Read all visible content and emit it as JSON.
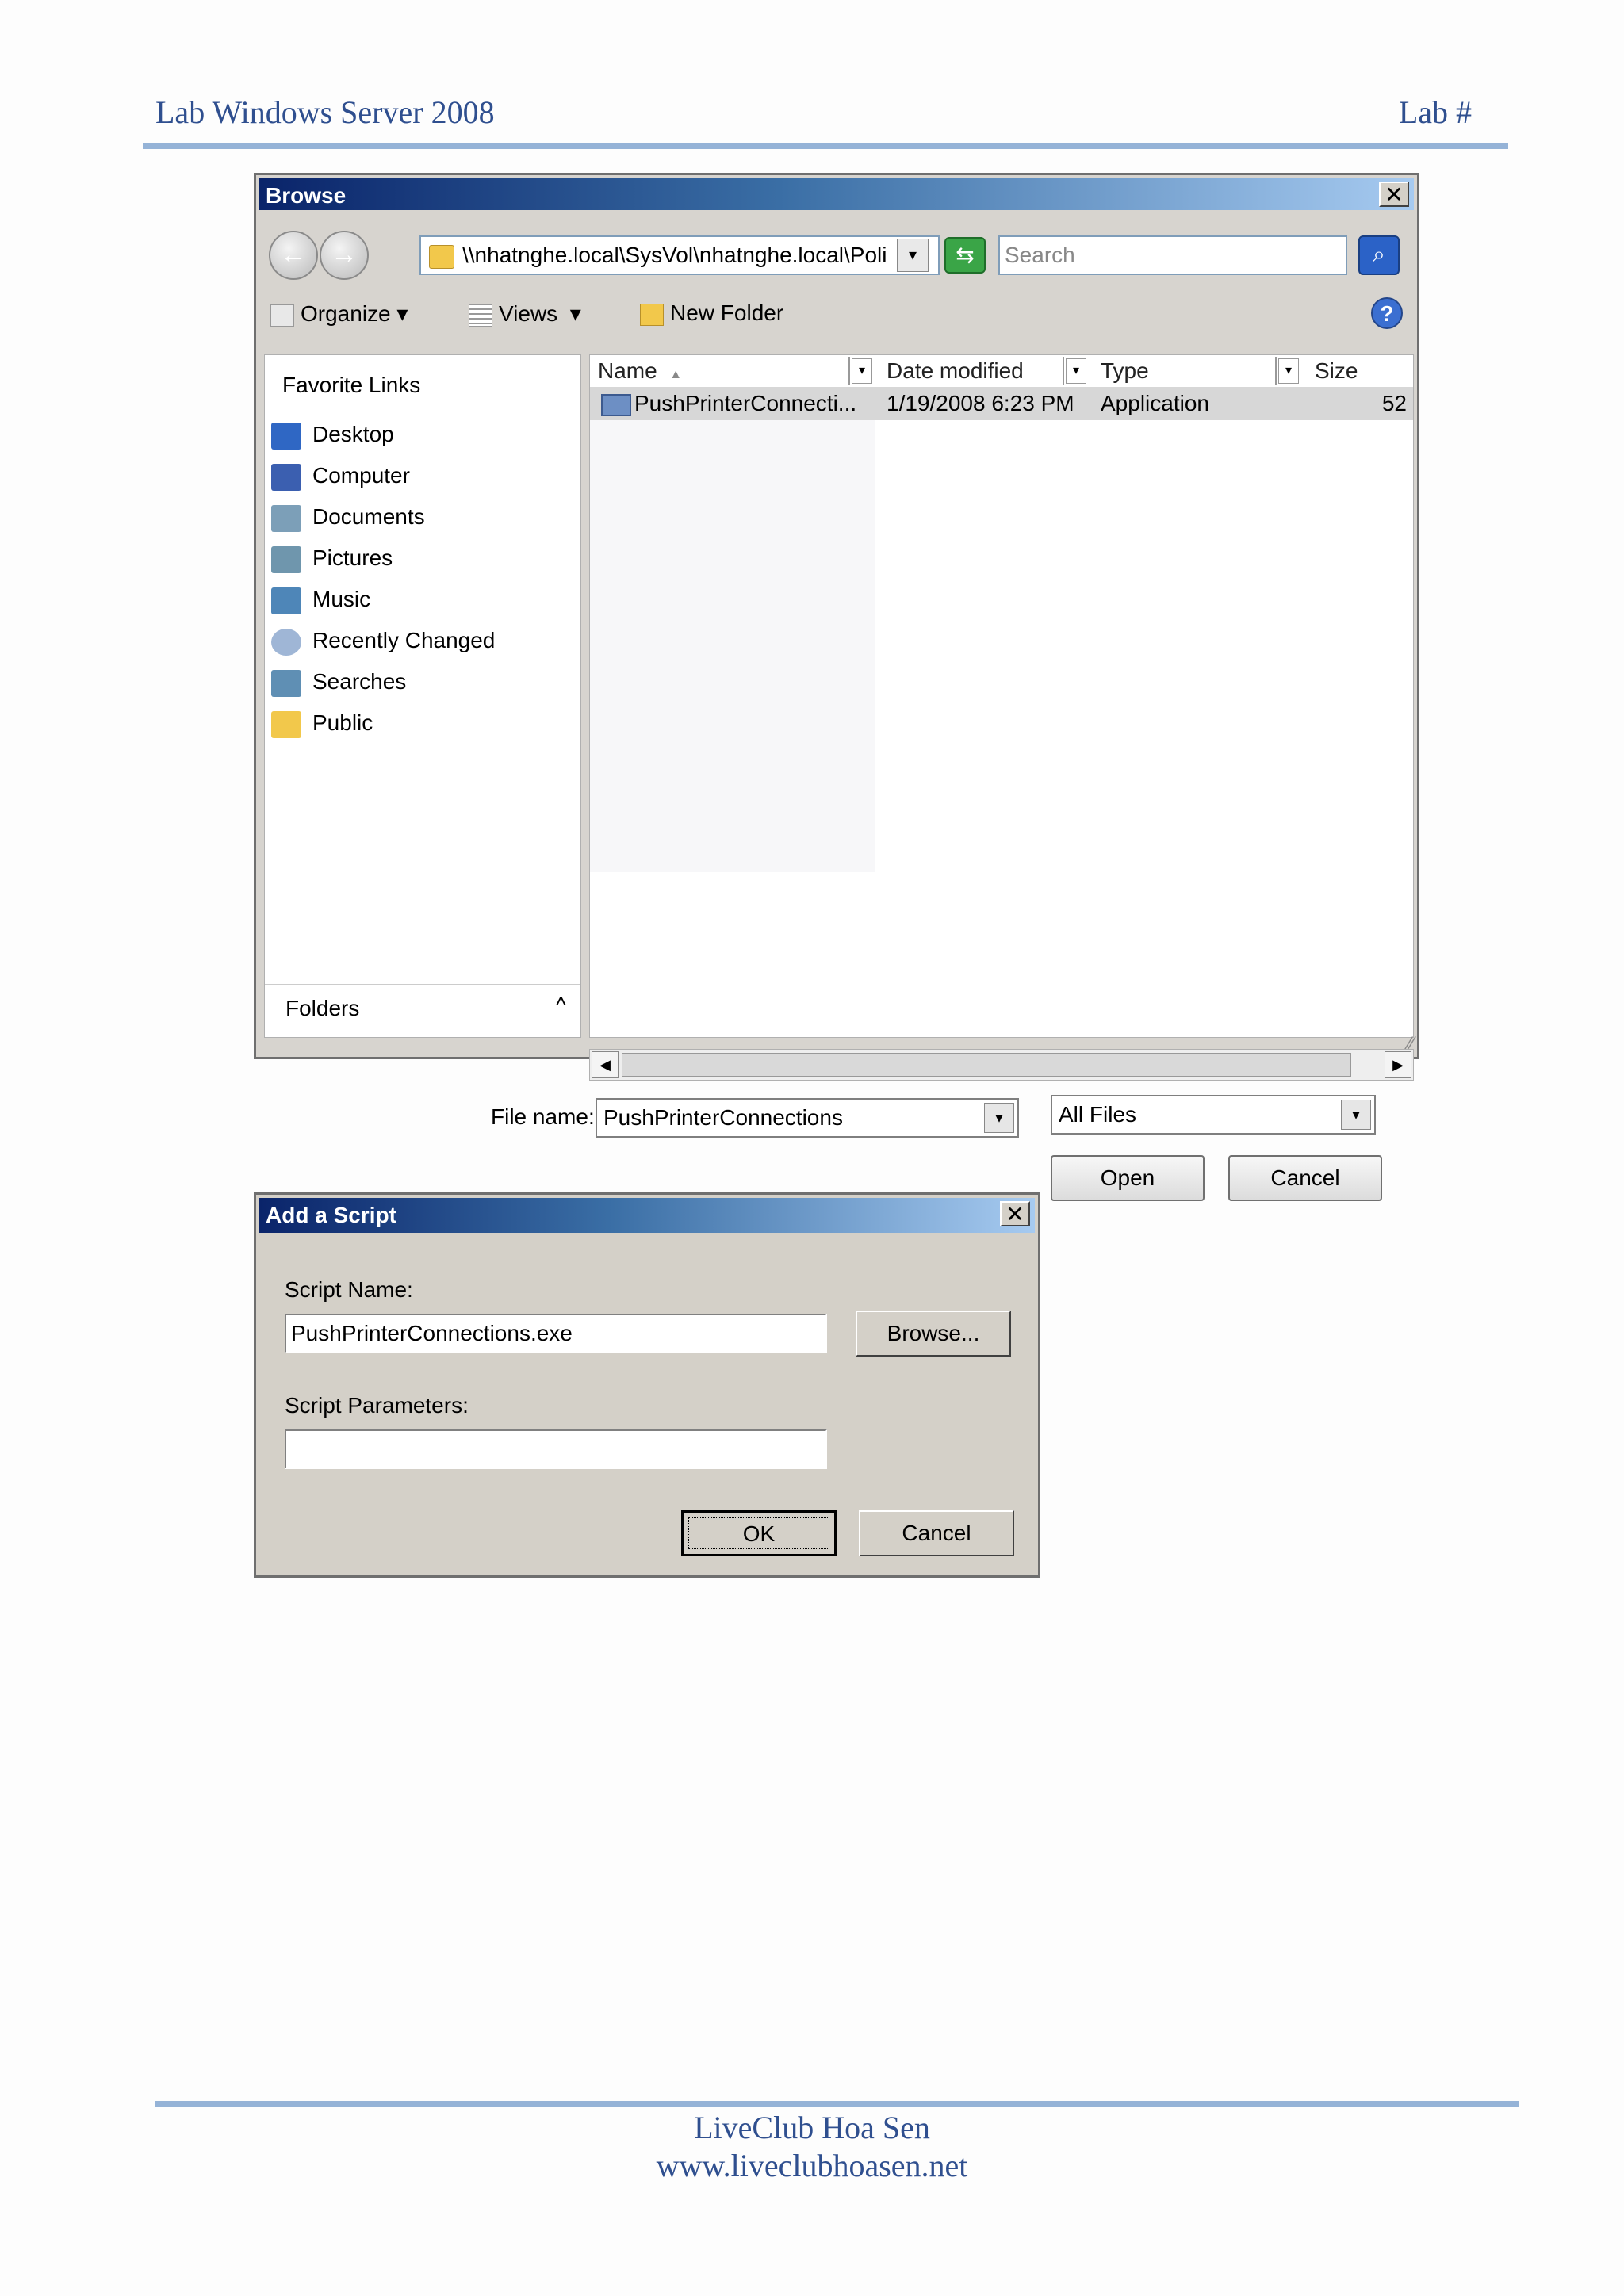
{
  "header": {
    "left": "Lab Windows Server 2008",
    "right": "Lab #"
  },
  "footer": {
    "line1": "LiveClub Hoa Sen",
    "line2": "www.liveclubhoasen.net"
  },
  "browse": {
    "title": "Browse",
    "close": "✕",
    "back": "←",
    "forward": "→",
    "address": "\\\\nhatnghe.local\\SysVol\\nhatnghe.local\\Poli",
    "search_placeholder": "Search",
    "search_glyph": "⌕",
    "refresh_glyph": "⇆",
    "toolbar": {
      "organize": "Organize",
      "views": "Views",
      "new_folder": "New Folder",
      "dropdown": "▾",
      "help": "?"
    },
    "favorites_heading": "Favorite Links",
    "favorites": [
      "Desktop",
      "Computer",
      "Documents",
      "Pictures",
      "Music",
      "Recently Changed",
      "Searches",
      "Public"
    ],
    "folders_label": "Folders",
    "folders_caret": "^",
    "columns": {
      "name": "Name",
      "date": "Date modified",
      "type": "Type",
      "size": "Size",
      "sort": "▲",
      "drop": "▾"
    },
    "file": {
      "name": "PushPrinterConnecti...",
      "date": "1/19/2008 6:23 PM",
      "type": "Application",
      "size": "52"
    },
    "scroll_left": "◀",
    "scroll_right": "▶",
    "filename_label": "File name:",
    "filename_value": "PushPrinterConnections",
    "filetype_value": "All Files",
    "open": "Open",
    "cancel": "Cancel",
    "grip": "⁄⁄"
  },
  "script_dialog": {
    "title": "Add a Script",
    "close": "✕",
    "name_label": "Script Name:",
    "name_value": "PushPrinterConnections.exe",
    "browse": "Browse...",
    "params_label": "Script Parameters:",
    "params_value": "",
    "ok": "OK",
    "cancel": "Cancel"
  },
  "colors": {
    "title_gradient_start": "#0a246a",
    "title_gradient_end": "#a6caf0",
    "rule": "#95b3d7",
    "header_text": "#2f4f8f"
  }
}
